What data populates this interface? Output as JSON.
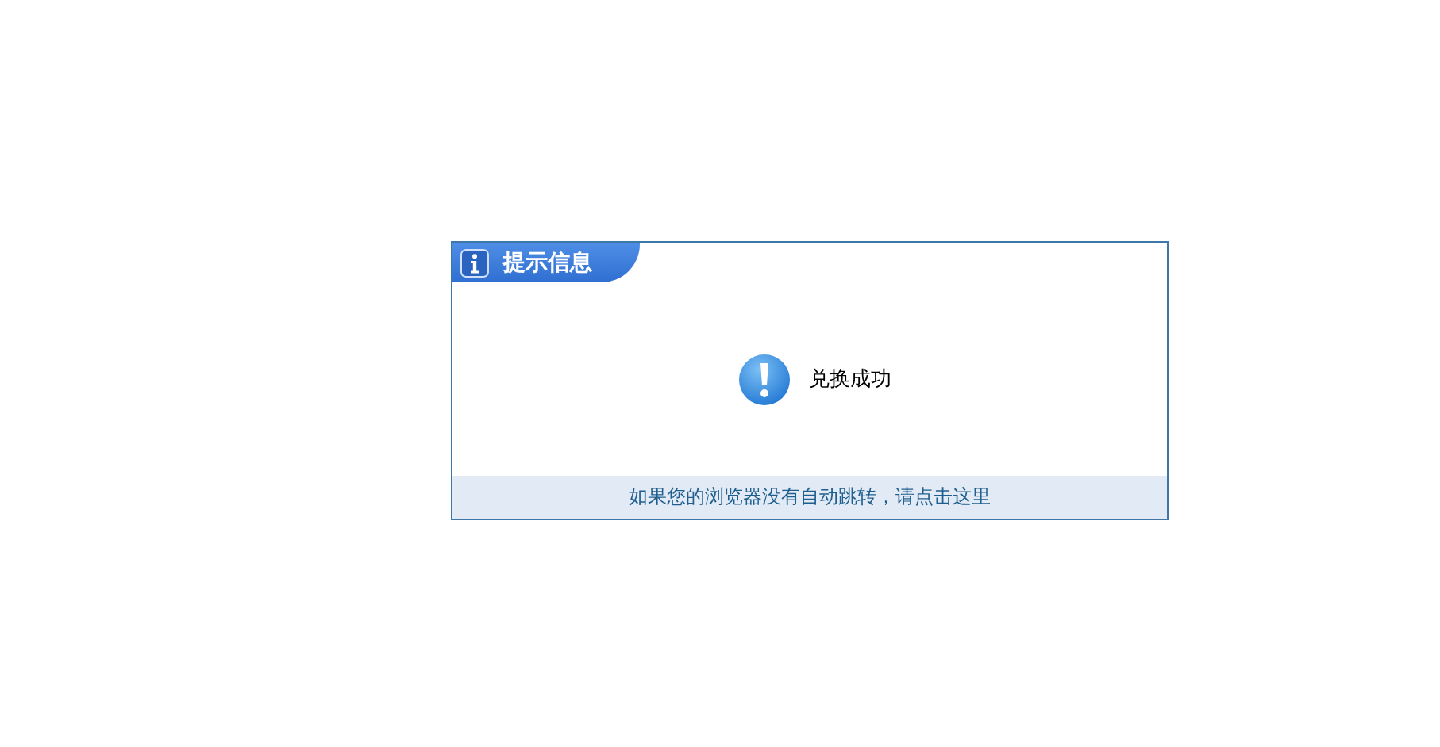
{
  "dialog": {
    "title": "提示信息",
    "message": "兑换成功",
    "redirect_link": "如果您的浏览器没有自动跳转，请点击这里"
  }
}
